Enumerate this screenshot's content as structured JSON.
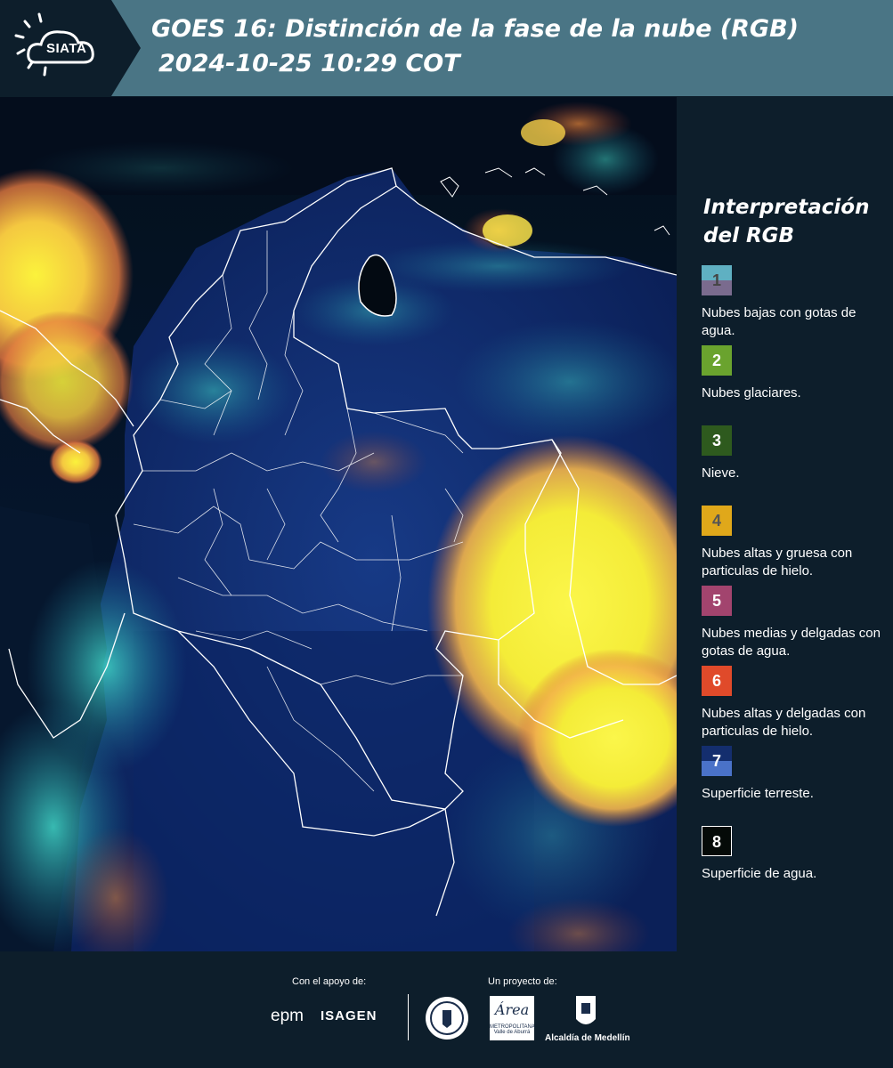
{
  "header": {
    "logo_text": "SIATA",
    "title_line1": "GOES 16: Distinción de la fase de la nube (RGB)",
    "title_line2": "2024-10-25 10:29 COT"
  },
  "legend": {
    "title": "Interpretación del RGB",
    "items": [
      {
        "number": "1",
        "label": "Nubes bajas con gotas de agua.",
        "color_top": "#5fb0c2",
        "color_bottom": "#7a6b8e",
        "text_color": "#444444"
      },
      {
        "number": "2",
        "label": "Nubes glaciares.",
        "color_top": "#6aa32e",
        "color_bottom": "#6aa32e",
        "text_color": "#ffffff"
      },
      {
        "number": "3",
        "label": "Nieve.",
        "color_top": "#2e5a1e",
        "color_bottom": "#2e5a1e",
        "text_color": "#ffffff"
      },
      {
        "number": "4",
        "label": "Nubes altas y gruesa con particulas de hielo.",
        "color_top": "#e0a81a",
        "color_bottom": "#e0a81a",
        "text_color": "#555555"
      },
      {
        "number": "5",
        "label": "Nubes medias y delgadas con gotas de agua.",
        "color_top": "#a2446e",
        "color_bottom": "#a2446e",
        "text_color": "#ffffff"
      },
      {
        "number": "6",
        "label": "Nubes altas y delgadas con particulas de hielo.",
        "color_top": "#e04a2a",
        "color_bottom": "#e04a2a",
        "text_color": "#ffffff"
      },
      {
        "number": "7",
        "label": "Superficie terreste.",
        "color_top": "#142e6e",
        "color_bottom": "#4a72c8",
        "text_color": "#ffffff"
      },
      {
        "number": "8",
        "label": "Superficie de agua.",
        "color_top": "#050a08",
        "color_bottom": "#050a08",
        "text_color": "#ffffff"
      }
    ]
  },
  "footer": {
    "support_label": "Con el apoyo de:",
    "project_label": "Un proyecto de:",
    "epm": "epm",
    "isagen": "ISAGEN",
    "area_logo": "Área",
    "area_sub": "METROPOLITANA Valle de Aburrá",
    "medellin": "Alcaldía de Medellín"
  },
  "colors": {
    "header_bg": "#4a7585",
    "page_bg": "#0d1e2b",
    "land_blue": "#0f2a6a",
    "ocean": "#040c14",
    "cloud_yellow": "#f6f03c",
    "cloud_orange": "#f0823c",
    "cloud_cyan": "#2fc8c8"
  }
}
